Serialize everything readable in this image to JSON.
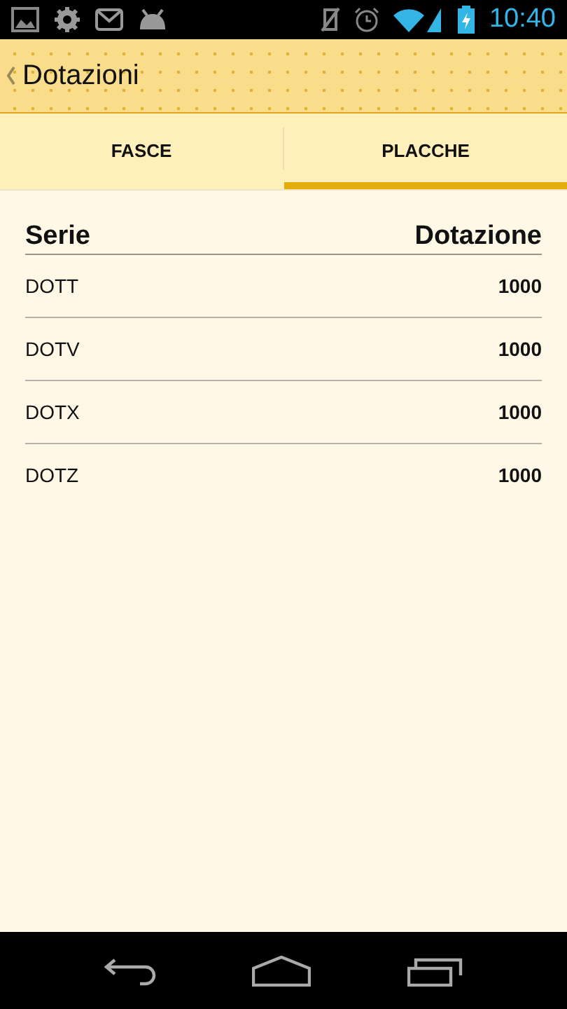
{
  "status_bar": {
    "time": "10:40"
  },
  "action_bar": {
    "title": "Dotazioni"
  },
  "tabs": [
    {
      "label": "FASCE",
      "selected": false
    },
    {
      "label": "PLACCHE",
      "selected": true
    }
  ],
  "table": {
    "columns": [
      "Serie",
      "Dotazione"
    ],
    "rows": [
      [
        "DOTT",
        "1000"
      ],
      [
        "DOTV",
        "1000"
      ],
      [
        "DOTX",
        "1000"
      ],
      [
        "DOTZ",
        "1000"
      ]
    ]
  }
}
